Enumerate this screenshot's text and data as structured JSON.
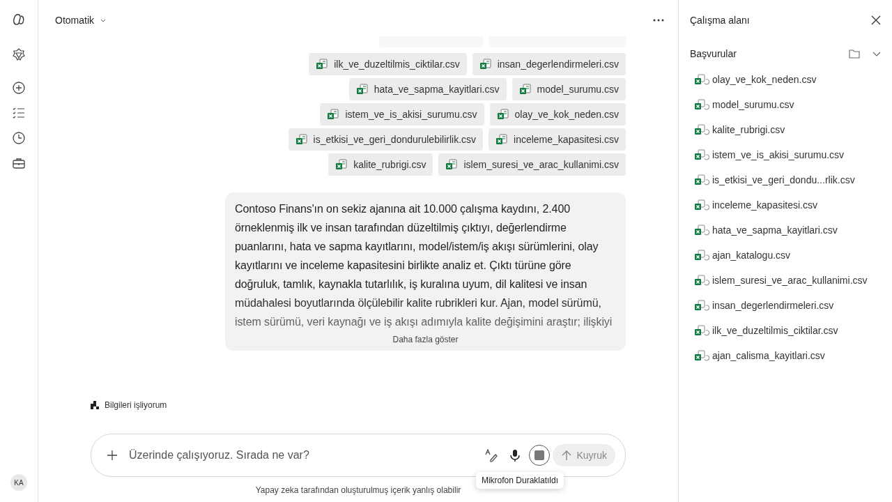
{
  "header": {
    "mode": "Otomatik"
  },
  "chip_rows": [
    [
      {
        "name": "ilk_ve_duzeltilmis_ciktilar.csv"
      },
      {
        "name": "insan_degerlendirmeleri.csv"
      }
    ],
    [
      {
        "name": "hata_ve_sapma_kayitlari.csv"
      },
      {
        "name": "model_surumu.csv"
      }
    ],
    [
      {
        "name": "istem_ve_is_akisi_surumu.csv"
      },
      {
        "name": "olay_ve_kok_neden.csv"
      }
    ],
    [
      {
        "name": "is_etkisi_ve_geri_dondurulebilirlik.csv"
      },
      {
        "name": "inceleme_kapasitesi.csv"
      }
    ],
    [
      {
        "name": "kalite_rubrigi.csv"
      },
      {
        "name": "islem_suresi_ve_arac_kullanimi.csv"
      }
    ]
  ],
  "message": {
    "text": "Contoso Finans'ın on sekiz ajanına ait 10.000 çalışma kaydını, 2.400 örneklenmiş ilk ve insan tarafından düzeltilmiş çıktıyı, değerlendirme puanlarını, hata ve sapma kayıtlarını, model/istem/iş akışı sürümlerini, olay kayıtlarını ve inceleme kapasitesini birlikte analiz et. Çıktı türüne göre doğruluk, tamlık, kaynakla tutarlılık, iş kuralına uyum, dil kalitesi ve insan müdahalesi boyutlarında ölçülebilir kalite rubrikleri kur. Ajan, model sürümü, istem sürümü, veri kaynağı ve iş akışı adımıyla kalite değişimini araştır; ilişkiyi",
    "show_more": "Daha fazla göster"
  },
  "status": "Bilgileri işliyorum",
  "composer": {
    "placeholder": "Üzerinde çalışıyoruz. Sırada ne var?",
    "send_label": "Kuyruk",
    "tooltip": "Mikrofon Duraklatıldı"
  },
  "disclaimer": "Yapay zeka tarafından oluşturulmuş içerik yanlış olabilir",
  "user": {
    "initials": "KA"
  },
  "workspace": {
    "title": "Çalışma alanı",
    "section": "Başvurular",
    "files": [
      {
        "name": "olay_ve_kok_neden.csv"
      },
      {
        "name": "model_surumu.csv"
      },
      {
        "name": "kalite_rubrigi.csv"
      },
      {
        "name": "istem_ve_is_akisi_surumu.csv"
      },
      {
        "name": "is_etkisi_ve_geri_dondu...rlik.csv"
      },
      {
        "name": "inceleme_kapasitesi.csv"
      },
      {
        "name": "hata_ve_sapma_kayitlari.csv"
      },
      {
        "name": "ajan_katalogu.csv"
      },
      {
        "name": "islem_suresi_ve_arac_kullanimi.csv"
      },
      {
        "name": "insan_degerlendirmeleri.csv"
      },
      {
        "name": "ilk_ve_duzeltilmis_ciktilar.csv"
      },
      {
        "name": "ajan_calisma_kayitlari.csv"
      }
    ]
  }
}
